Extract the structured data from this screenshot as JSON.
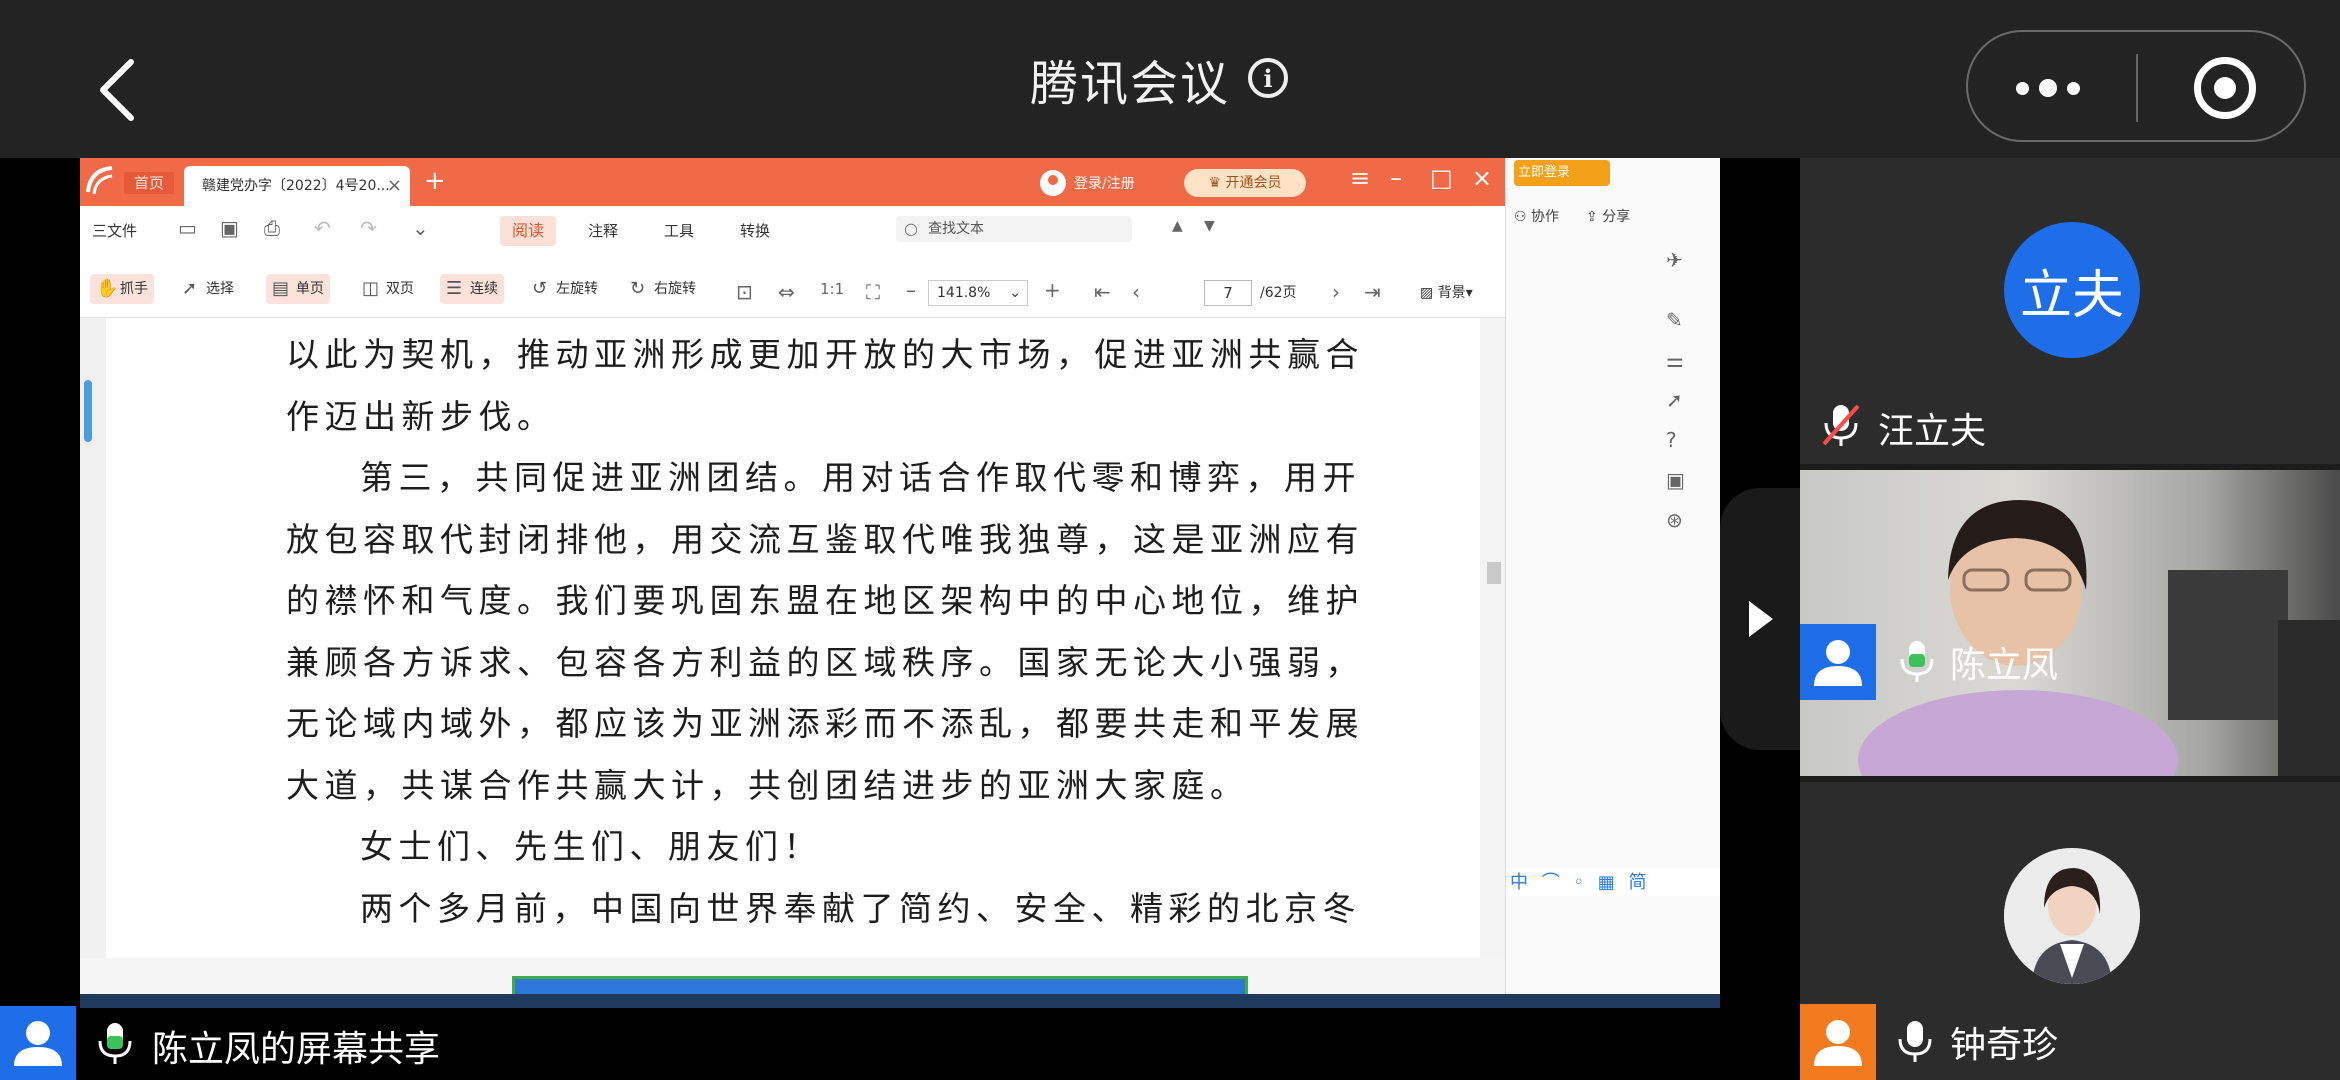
{
  "meeting": {
    "title": "腾讯会议"
  },
  "wps": {
    "home_tab": "首页",
    "doc_tab": "赣建党办字〔2022〕4号20...",
    "login_label": "登录/注册",
    "vip_label": "开通会员",
    "menu": {
      "file": "三文件",
      "tabs": [
        "阅读",
        "注释",
        "工具",
        "转换"
      ]
    },
    "search_placeholder": "查找文本",
    "toolbar": {
      "hand": "抓手",
      "select": "选择",
      "single": "单页",
      "double": "双页",
      "continuous": "连续",
      "rotate_left": "左旋转",
      "rotate_right": "右旋转",
      "zoom": "141.8%",
      "page": "7",
      "page_total": "/62页",
      "background": "背景"
    },
    "side": {
      "login": "立即登录",
      "collab": "协作",
      "share": "分享"
    },
    "ime": "中 ⌒ ◦ ▦ 简",
    "document_lines": [
      {
        "text": "以此为契机，推动亚洲形成更加开放的大市场，促进亚洲共赢合",
        "indent": false
      },
      {
        "text": "作迈出新步伐。",
        "indent": false
      },
      {
        "text": "第三，共同促进亚洲团结。用对话合作取代零和博弈，用开",
        "indent": true
      },
      {
        "text": "放包容取代封闭排他，用交流互鉴取代唯我独尊，这是亚洲应有",
        "indent": false
      },
      {
        "text": "的襟怀和气度。我们要巩固东盟在地区架构中的中心地位，维护",
        "indent": false
      },
      {
        "text": "兼顾各方诉求、包容各方利益的区域秩序。国家无论大小强弱，",
        "indent": false
      },
      {
        "text": "无论域内域外，都应该为亚洲添彩而不添乱，都要共走和平发展",
        "indent": false
      },
      {
        "text": "大道，共谋合作共赢大计，共创团结进步的亚洲大家庭。",
        "indent": false
      },
      {
        "text": "女士们、先生们、朋友们！",
        "indent": true
      },
      {
        "text": "两个多月前，中国向世界奉献了简约、安全、精彩的北京冬",
        "indent": true
      }
    ]
  },
  "participants": [
    {
      "avatar_text": "立夫",
      "name": "汪立夫",
      "muted": true
    },
    {
      "name": "陈立凤",
      "muted": false
    },
    {
      "name": "钟奇珍",
      "muted": false
    }
  ],
  "share_label": "陈立凤的屏幕共享",
  "colors": {
    "wps_accent": "#f06a48",
    "avatar_blue": "#1d6ee8",
    "avatar_orange": "#f27b20",
    "mic_green": "#3cc25a"
  }
}
